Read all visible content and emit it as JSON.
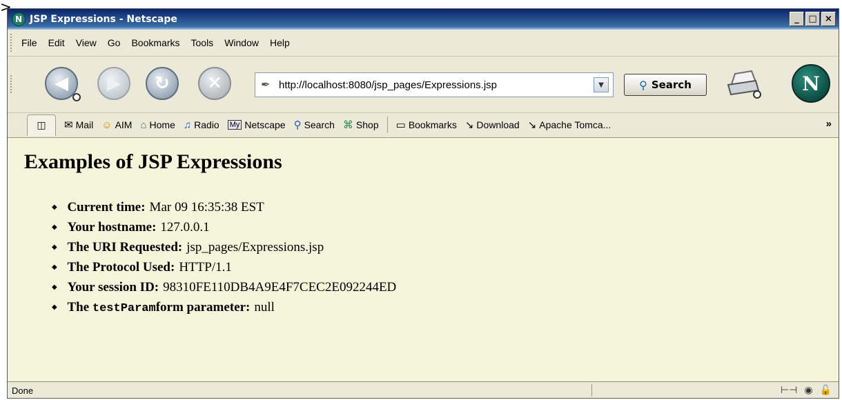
{
  "window": {
    "title": "JSP Expressions - Netscape",
    "app_icon": "netscape-icon",
    "controls": {
      "minimize": "_",
      "maximize": "□",
      "close": "×"
    }
  },
  "menubar": {
    "items": [
      "File",
      "Edit",
      "View",
      "Go",
      "Bookmarks",
      "Tools",
      "Window",
      "Help"
    ]
  },
  "navbar": {
    "buttons": [
      {
        "name": "back",
        "icon": "back-arrow-icon",
        "glyph": "◀",
        "enabled": true
      },
      {
        "name": "forward",
        "icon": "forward-arrow-icon",
        "glyph": "▶",
        "enabled": false
      },
      {
        "name": "reload",
        "icon": "reload-icon",
        "glyph": "↻",
        "enabled": true
      },
      {
        "name": "stop",
        "icon": "stop-icon",
        "glyph": "✕",
        "enabled": false
      }
    ],
    "url": "http://localhost:8080/jsp_pages/Expressions.jsp",
    "search_label": "Search"
  },
  "personal_toolbar": {
    "items": [
      {
        "label": "Mail",
        "icon": "mail-icon",
        "glyph": "✉"
      },
      {
        "label": "AIM",
        "icon": "aim-icon",
        "glyph": "☺"
      },
      {
        "label": "Home",
        "icon": "home-icon",
        "glyph": "⌂"
      },
      {
        "label": "Radio",
        "icon": "radio-icon",
        "glyph": "♫"
      },
      {
        "label": "Netscape",
        "icon": "my-netscape-icon",
        "glyph": "My"
      },
      {
        "label": "Search",
        "icon": "search-icon",
        "glyph": "⚲"
      },
      {
        "label": "Shop",
        "icon": "shop-icon",
        "glyph": "⌘"
      }
    ],
    "bookmarks": [
      {
        "label": "Bookmarks",
        "icon": "folder-icon",
        "glyph": "▭"
      },
      {
        "label": "Download",
        "icon": "bookmark-icon",
        "glyph": "↘"
      },
      {
        "label": "Apache Tomca...",
        "icon": "bookmark-icon",
        "glyph": "↘"
      }
    ],
    "more": "»"
  },
  "content": {
    "heading": "Examples of JSP Expressions",
    "items": [
      {
        "label": "Current time:",
        "value": "Mar 09 16:35:38 EST"
      },
      {
        "label": "Your hostname:",
        "value": "127.0.0.1"
      },
      {
        "label": "The URI Requested:",
        "value": "jsp_pages/Expressions.jsp"
      },
      {
        "label": "The Protocol Used:",
        "value": "HTTP/1.1"
      },
      {
        "label": "Your session ID:",
        "value": "98310FE110DB4A9E4F7CEC2E092244ED"
      },
      {
        "label_prefix": "The",
        "label_code": "testParam",
        "label_suffix": "form parameter:",
        "value": "null"
      }
    ],
    "background": "#f5f5dc"
  },
  "statusbar": {
    "text": "Done",
    "icons": [
      "connection-icon",
      "security-eye-icon",
      "unlocked-padlock-icon"
    ]
  }
}
